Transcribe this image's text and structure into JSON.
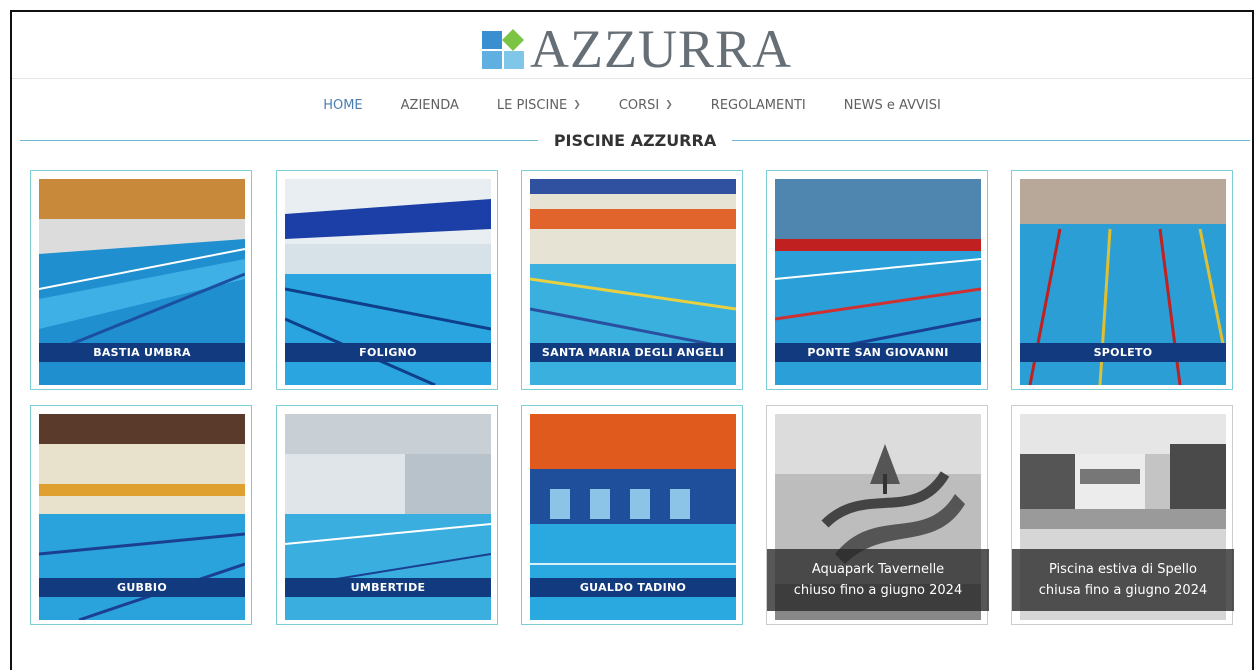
{
  "brand": {
    "name": "AZZURRA",
    "logo_icon": "azzurra-logo-icon"
  },
  "nav": {
    "items": [
      {
        "label": "HOME",
        "active": true,
        "dropdown": false
      },
      {
        "label": "AZIENDA",
        "active": false,
        "dropdown": false
      },
      {
        "label": "LE PISCINE",
        "active": false,
        "dropdown": true
      },
      {
        "label": "CORSI",
        "active": false,
        "dropdown": true
      },
      {
        "label": "REGOLAMENTI",
        "active": false,
        "dropdown": false
      },
      {
        "label": "NEWS e AVVISI",
        "active": false,
        "dropdown": false
      }
    ]
  },
  "section": {
    "title": "PISCINE AZZURRA"
  },
  "pools": [
    {
      "name": "BASTIA UMBRA"
    },
    {
      "name": "FOLIGNO"
    },
    {
      "name": "SANTA MARIA DEGLI ANGELI"
    },
    {
      "name": "PONTE SAN GIOVANNI"
    },
    {
      "name": "SPOLETO"
    },
    {
      "name": "GUBBIO"
    },
    {
      "name": "UMBERTIDE"
    },
    {
      "name": "GUALDO TADINO"
    }
  ],
  "closed": [
    {
      "line1": "Aquapark Tavernelle",
      "line2": "chiuso fino a giugno 2024"
    },
    {
      "line1": "Piscina estiva di Spello",
      "line2": "chiusa fino a giugno 2024"
    }
  ],
  "colors": {
    "banner": "#123a7e",
    "accent": "#4a7fb0",
    "card_border": "#7ccfd6"
  }
}
